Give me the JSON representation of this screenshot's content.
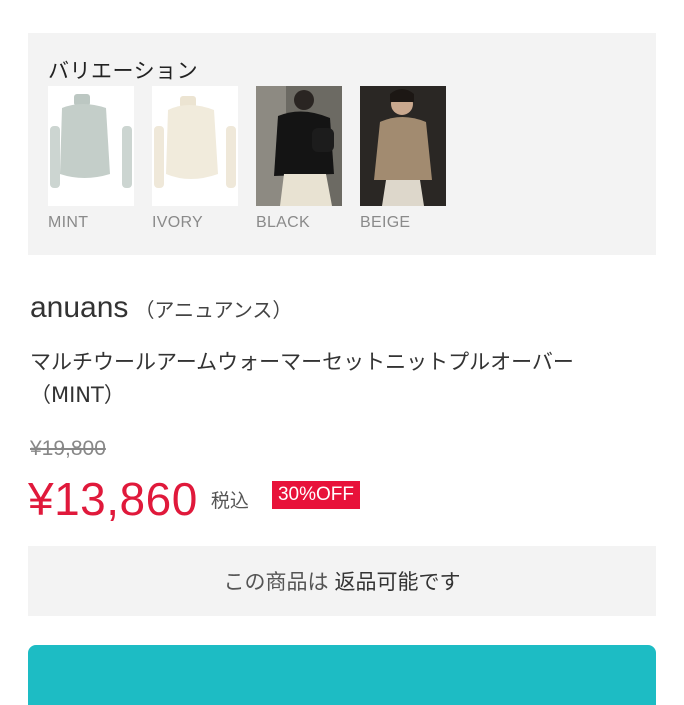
{
  "variation": {
    "title": "バリエーション",
    "items": [
      {
        "label": "MINT",
        "color": "#c9d3cf"
      },
      {
        "label": "IVORY",
        "color": "#f3eddf"
      },
      {
        "label": "BLACK",
        "color": "#1b1b1b"
      },
      {
        "label": "BEIGE",
        "color": "#a0896d"
      }
    ]
  },
  "product": {
    "brand": "anuans",
    "brand_kana": "（アニュアンス）",
    "name": "マルチウールアームウォーマーセットニットプルオーバー（MINT）",
    "original_price": "¥19,800",
    "price": "¥13,860",
    "tax_label": "税込",
    "discount_badge": "30%OFF"
  },
  "return_policy": {
    "prefix": "この商品は",
    "status": "返品可能です"
  },
  "colors": {
    "price_red": "#e0193b",
    "cart_teal": "#1dbcc4"
  }
}
